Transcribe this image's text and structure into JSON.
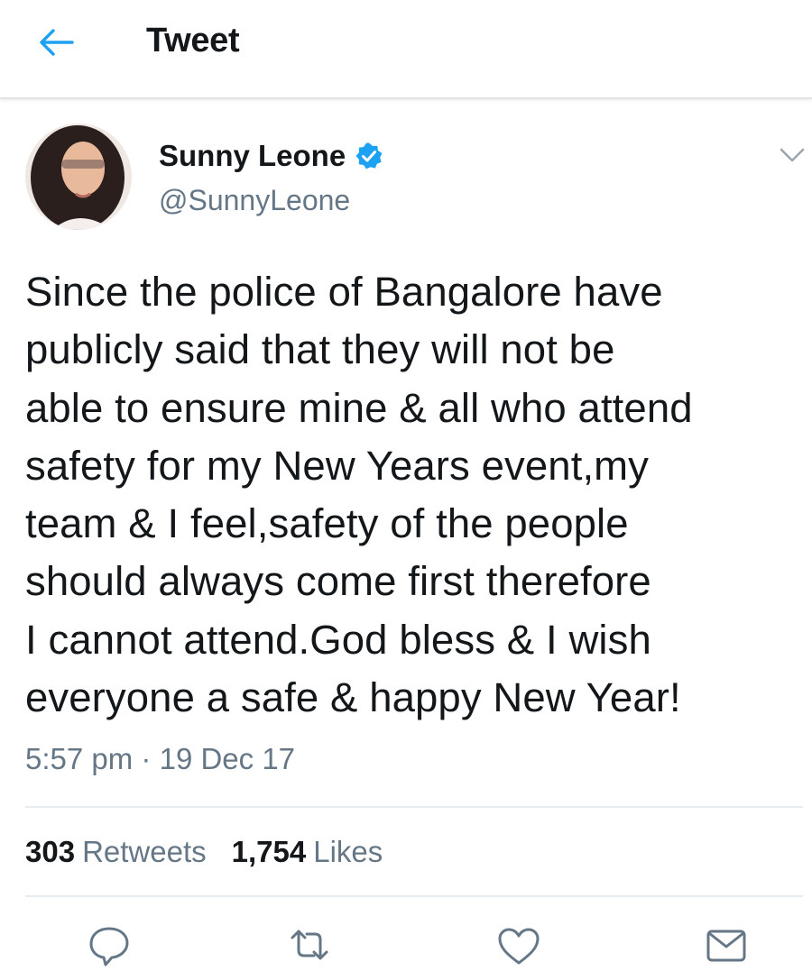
{
  "header": {
    "title": "Tweet",
    "back_icon": "back-arrow-icon"
  },
  "tweet": {
    "display_name": "Sunny Leone",
    "handle": "@SunnyLeone",
    "verified": true,
    "text": "Since the police of Bangalore have\npublicly said that they will not be\nable to ensure mine & all who attend\nsafety for my New Years event,my\nteam & I feel,safety of the people\nshould always come first therefore\nI cannot attend.God bless & I wish\neveryone a safe & happy New Year!",
    "time": "5:57 pm",
    "separator": "·",
    "date": "19 Dec 17"
  },
  "stats": {
    "retweets_count": "303",
    "retweets_label": "Retweets",
    "likes_count": "1,754",
    "likes_label": "Likes"
  },
  "actions": [
    "reply-icon",
    "retweet-icon",
    "like-icon",
    "share-icon"
  ],
  "colors": {
    "accent": "#1da1f2",
    "text": "#14171a",
    "secondary": "#657786",
    "divider": "#e6ecf0"
  }
}
